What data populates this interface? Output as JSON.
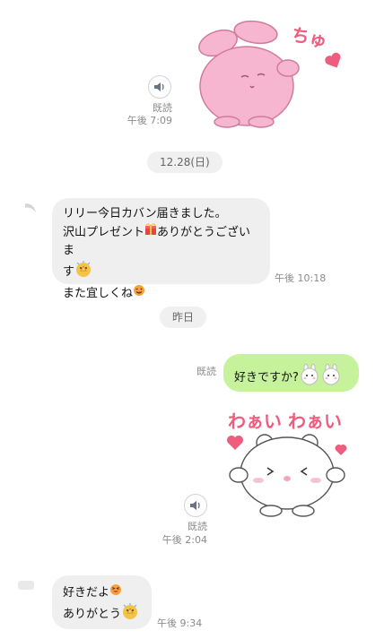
{
  "messages": {
    "m1": {
      "read": "既読",
      "time": "午後 7:09",
      "sticker_text": "ちゅ"
    },
    "date1": {
      "label": "12.28(日)"
    },
    "m2": {
      "lines": [
        "リリー今日カバン届きました。",
        "沢山プレゼント",
        "ありがとうございま",
        "す",
        "また宜しくね"
      ],
      "time": "午後 10:18"
    },
    "date2": {
      "label": "昨日"
    },
    "m3": {
      "read": "既読",
      "text": "好きですか?"
    },
    "m4": {
      "read": "既読",
      "time": "午後 2:04",
      "sticker_text": "わぁい わぁい"
    },
    "m5": {
      "lines": [
        "好きだよ",
        "ありがとう"
      ],
      "time": "午後 9:34"
    }
  },
  "colors": {
    "incoming": "#efefef",
    "outgoing": "#c7f29c",
    "pink_sticker": "#f7b6cf"
  }
}
